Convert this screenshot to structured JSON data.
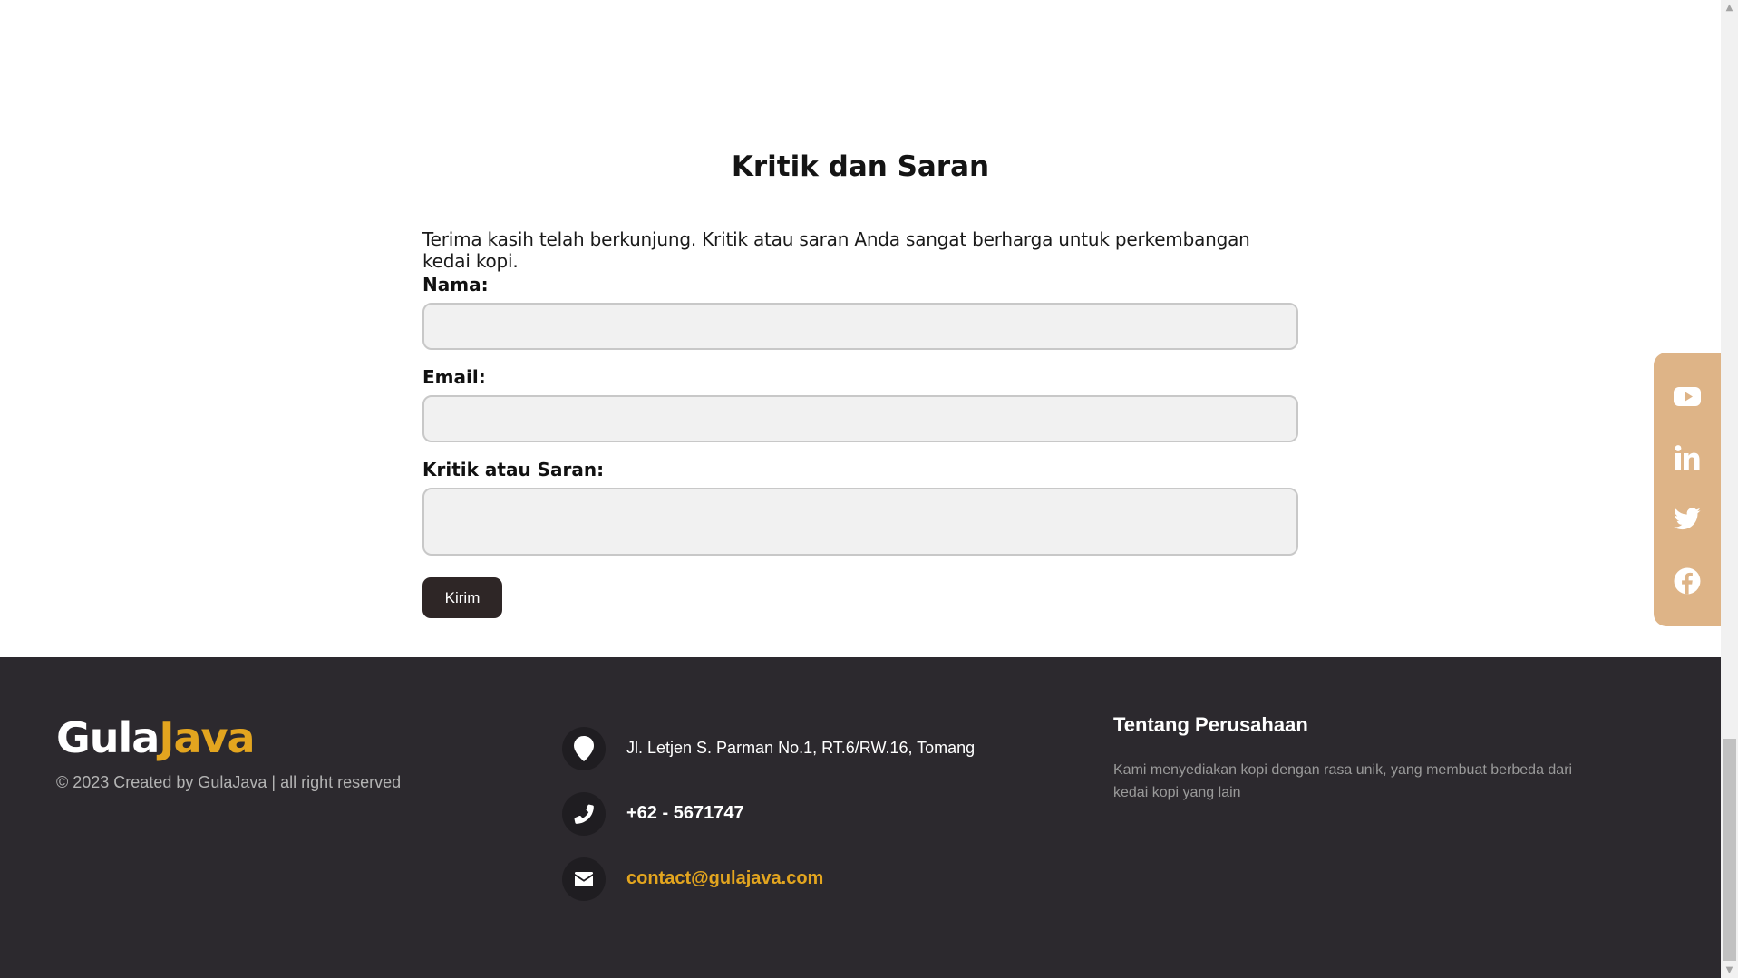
{
  "feedback": {
    "title": "Kritik dan Saran",
    "intro": "Terima kasih telah berkunjung. Kritik atau saran Anda sangat berharga untuk perkembangan kedai kopi.",
    "name_label": "Nama:",
    "name_value": "",
    "email_label": "Email:",
    "email_value": "",
    "message_label": "Kritik atau Saran:",
    "message_value": "",
    "submit_label": "Kirim"
  },
  "social": {
    "icons": [
      "youtube-icon",
      "linkedin-icon",
      "twitter-icon",
      "facebook-icon"
    ],
    "background": "#deb487"
  },
  "footer": {
    "logo_part1": "Gula",
    "logo_part2": "Java",
    "copyright": "© 2023 Created by GulaJava | all right reserved",
    "address": "Jl. Letjen S. Parman No.1, RT.6/RW.16, Tomang",
    "phone": "+62 - 5671747",
    "email": "contact@gulajava.com",
    "about_title": "Tentang Perusahaan",
    "about_text": "Kami menyediakan kopi dengan rasa unik, yang membuat berbeda dari kedai kopi yang lain",
    "background": "#2c292e",
    "accent": "#e3a51f"
  }
}
